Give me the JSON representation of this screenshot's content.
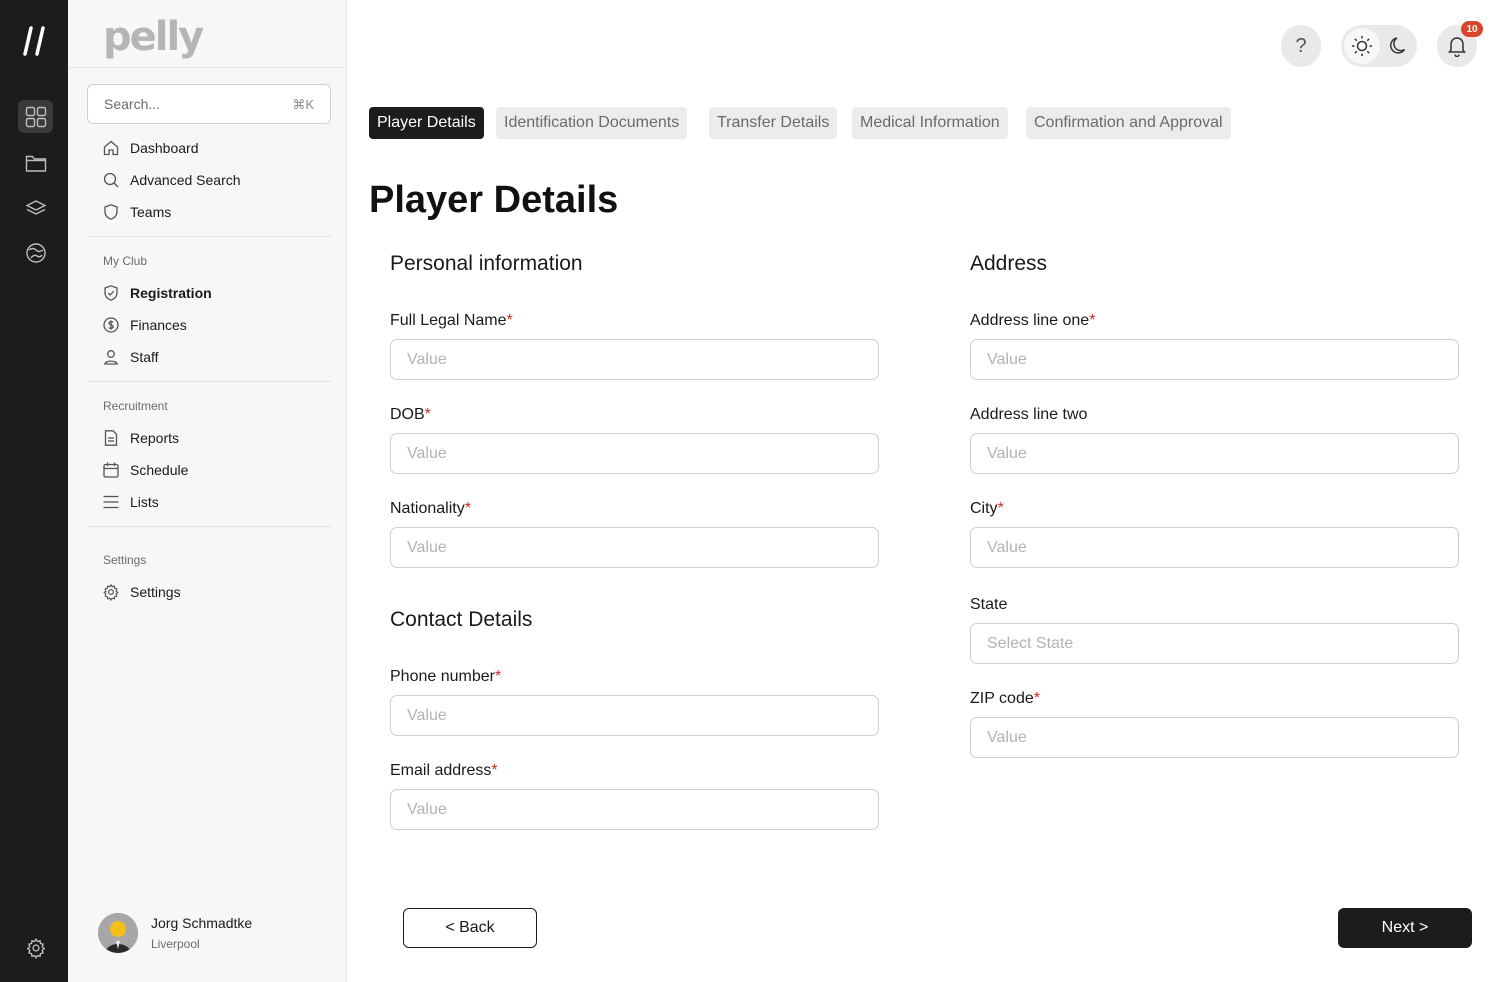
{
  "app": {
    "brand": "pelly"
  },
  "sidebar": {
    "search": {
      "placeholder": "Search...",
      "shortcut": "⌘K"
    },
    "top_items": [
      {
        "label": "Dashboard",
        "icon": "home-icon"
      },
      {
        "label": "Advanced Search",
        "icon": "search-icon"
      },
      {
        "label": "Teams",
        "icon": "shield-icon"
      }
    ],
    "sections": [
      {
        "title": "My Club",
        "items": [
          {
            "label": "Registration",
            "icon": "shield-check-icon",
            "active": true
          },
          {
            "label": "Finances",
            "icon": "dollar-icon"
          },
          {
            "label": "Staff",
            "icon": "user-icon"
          }
        ]
      },
      {
        "title": "Recruitment",
        "items": [
          {
            "label": "Reports",
            "icon": "document-icon"
          },
          {
            "label": "Schedule",
            "icon": "calendar-icon"
          },
          {
            "label": "Lists",
            "icon": "list-icon"
          }
        ]
      },
      {
        "title": "Settings",
        "items": [
          {
            "label": "Settings",
            "icon": "gear-icon"
          }
        ]
      }
    ],
    "user": {
      "name": "Jorg Schmadtke",
      "club": "Liverpool"
    }
  },
  "header": {
    "help_label": "?",
    "notification_count": "10"
  },
  "tabs": [
    {
      "label": "Player Details",
      "active": true
    },
    {
      "label": "Identification Documents"
    },
    {
      "label": "Transfer Details"
    },
    {
      "label": "Medical Information"
    },
    {
      "label": "Confirmation and Approval"
    }
  ],
  "page": {
    "title": "Player Details",
    "personal": {
      "title": "Personal information",
      "full_name": {
        "label": "Full Legal Name",
        "required": "*",
        "placeholder": "Value",
        "value": ""
      },
      "dob": {
        "label": "DOB",
        "required": "*",
        "placeholder": "Value",
        "value": ""
      },
      "nationality": {
        "label": "Nationality",
        "required": "*",
        "placeholder": "Value",
        "value": ""
      }
    },
    "contact": {
      "title": "Contact Details",
      "phone": {
        "label": "Phone number",
        "required": "*",
        "placeholder": "Value",
        "value": ""
      },
      "email": {
        "label": "Email address",
        "required": "*",
        "placeholder": "Value",
        "value": ""
      }
    },
    "address": {
      "title": "Address",
      "line_one": {
        "label": "Address line one",
        "required": "*",
        "placeholder": "Value",
        "value": ""
      },
      "line_two": {
        "label": "Address line two",
        "placeholder": "Value",
        "value": ""
      },
      "city": {
        "label": "City",
        "required": "*",
        "placeholder": "Value",
        "value": ""
      },
      "state": {
        "label": "State",
        "placeholder": "Select State",
        "value": ""
      },
      "zip": {
        "label": "ZIP code",
        "required": "*",
        "placeholder": "Value",
        "value": ""
      }
    }
  },
  "footer": {
    "back_label": "< Back",
    "next_label": "Next >"
  },
  "colors": {
    "rail": "#1c1c1c",
    "accent": "#1c1c1c",
    "required": "#d62828",
    "badge": "#d9462b"
  }
}
